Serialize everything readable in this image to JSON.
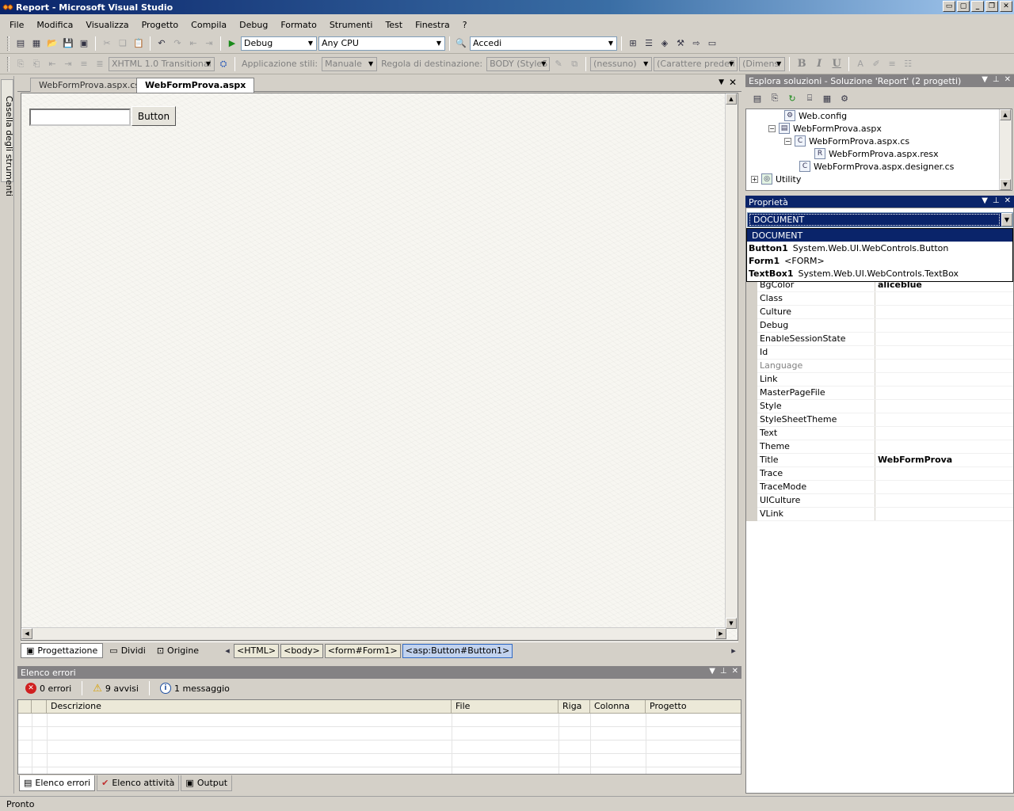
{
  "window": {
    "title": "Report - Microsoft Visual Studio"
  },
  "menu": [
    "File",
    "Modifica",
    "Visualizza",
    "Progetto",
    "Compila",
    "Debug",
    "Formato",
    "Strumenti",
    "Test",
    "Finestra",
    "?"
  ],
  "toolbar1": {
    "config": "Debug",
    "platform": "Any CPU",
    "find": "Accedi"
  },
  "toolbar2": {
    "doctype": "XHTML 1.0 Transitional (",
    "apply_styles_label": "Applicazione stili:",
    "apply_styles_value": "Manuale",
    "target_rule_label": "Regola di destinazione:",
    "target_rule_value": "BODY (StyleS",
    "block_format": "(nessuno)",
    "font_name": "(Carattere predefi",
    "font_size": "(Dimens",
    "bold": "B",
    "italic": "I",
    "underline": "U"
  },
  "toolbox": {
    "label": "Casella degli strumenti"
  },
  "editor": {
    "tabs": [
      {
        "label": "WebFormProva.aspx.cs"
      },
      {
        "label": "WebFormProva.aspx"
      }
    ],
    "design_button_label": "Button",
    "views": {
      "design": "Progettazione",
      "split": "Dividi",
      "source": "Origine"
    },
    "tag_path": [
      "<HTML>",
      "<body>",
      "<form#Form1>",
      "<asp:Button#Button1>"
    ]
  },
  "solution_explorer": {
    "title": "Esplora soluzioni - Soluzione 'Report' (2 progetti)",
    "items": [
      {
        "label": "Web.config"
      },
      {
        "label": "WebFormProva.aspx"
      },
      {
        "label": "WebFormProva.aspx.cs"
      },
      {
        "label": "WebFormProva.aspx.resx"
      },
      {
        "label": "WebFormProva.aspx.designer.cs"
      },
      {
        "label": "Utility"
      }
    ]
  },
  "properties": {
    "title": "Proprietà",
    "selected_object": "DOCUMENT",
    "dropdown": [
      {
        "name": "DOCUMENT",
        "type": ""
      },
      {
        "name": "Button1",
        "type": "System.Web.UI.WebControls.Button"
      },
      {
        "name": "Form1",
        "type": "<FORM>"
      },
      {
        "name": "TextBox1",
        "type": "System.Web.UI.WebControls.TextBox"
      }
    ],
    "rows": [
      {
        "name": "BgColor",
        "value": "aliceblue"
      },
      {
        "name": "Class",
        "value": ""
      },
      {
        "name": "Culture",
        "value": ""
      },
      {
        "name": "Debug",
        "value": ""
      },
      {
        "name": "EnableSessionState",
        "value": ""
      },
      {
        "name": "Id",
        "value": ""
      },
      {
        "name": "Language",
        "value": ""
      },
      {
        "name": "Link",
        "value": ""
      },
      {
        "name": "MasterPageFile",
        "value": ""
      },
      {
        "name": "Style",
        "value": ""
      },
      {
        "name": "StyleSheetTheme",
        "value": ""
      },
      {
        "name": "Text",
        "value": ""
      },
      {
        "name": "Theme",
        "value": ""
      },
      {
        "name": "Title",
        "value": "WebFormProva"
      },
      {
        "name": "Trace",
        "value": ""
      },
      {
        "name": "TraceMode",
        "value": ""
      },
      {
        "name": "UICulture",
        "value": ""
      },
      {
        "name": "VLink",
        "value": ""
      }
    ]
  },
  "error_list": {
    "title": "Elenco errori",
    "errors": "0 errori",
    "warnings": "9 avvisi",
    "messages": "1 messaggio",
    "columns": [
      "Descrizione",
      "File",
      "Riga",
      "Colonna",
      "Progetto"
    ]
  },
  "bottom_tabs": [
    "Elenco errori",
    "Elenco attività",
    "Output"
  ],
  "status": "Pronto",
  "colors": {
    "active_caption": "#0a246a",
    "inactive_caption": "#848284",
    "face": "#d4d0c8"
  }
}
